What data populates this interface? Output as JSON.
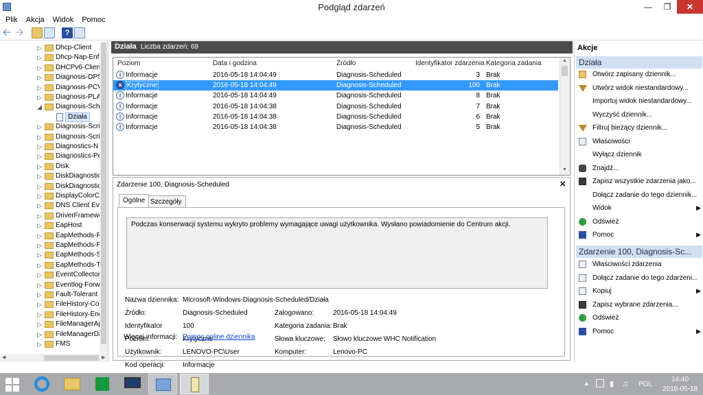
{
  "window": {
    "title": "Podgląd zdarzeń"
  },
  "menu": [
    "Plik",
    "Akcja",
    "Widok",
    "Pomoc"
  ],
  "tree": {
    "items": [
      {
        "label": "Dhcp-Client",
        "expander": "▷"
      },
      {
        "label": "Dhcp-Nap-Enf",
        "expander": "▷"
      },
      {
        "label": "DHCPv6-Clien",
        "expander": "▷"
      },
      {
        "label": "Diagnosis-DPS",
        "expander": "▷"
      },
      {
        "label": "Diagnosis-PCV",
        "expander": "▷"
      },
      {
        "label": "Diagnosis-PLA",
        "expander": "▷"
      },
      {
        "label": "Diagnosis-Sch",
        "expander": "◢"
      },
      {
        "label": "Działa",
        "expander": "",
        "child": true
      },
      {
        "label": "Diagnosis-Scri",
        "expander": "▷"
      },
      {
        "label": "Diagnosis-Scri",
        "expander": "▷"
      },
      {
        "label": "Diagnostics-N",
        "expander": "▷"
      },
      {
        "label": "Diagnostics-Pe",
        "expander": "▷"
      },
      {
        "label": "Disk",
        "expander": "▷"
      },
      {
        "label": "DiskDiagnostic",
        "expander": "▷"
      },
      {
        "label": "DiskDiagnostic",
        "expander": "▷"
      },
      {
        "label": "DisplayColorC",
        "expander": "▷"
      },
      {
        "label": "DNS Client Eve",
        "expander": "▷"
      },
      {
        "label": "DriverFramewo",
        "expander": "▷"
      },
      {
        "label": "EapHost",
        "expander": "▷"
      },
      {
        "label": "EapMethods-R",
        "expander": "▷"
      },
      {
        "label": "EapMethods-R",
        "expander": "▷"
      },
      {
        "label": "EapMethods-S",
        "expander": "▷"
      },
      {
        "label": "EapMethods-T",
        "expander": "▷"
      },
      {
        "label": "EventCollector",
        "expander": "▷"
      },
      {
        "label": "Eventlog-Forw",
        "expander": "▷"
      },
      {
        "label": "Fault-Tolerant",
        "expander": "▷"
      },
      {
        "label": "FileHistory-Co",
        "expander": "▷"
      },
      {
        "label": "FileHistory-Eng",
        "expander": "▷"
      },
      {
        "label": "FileManagerApp",
        "expander": "▷"
      },
      {
        "label": "FileManagerDa",
        "expander": "▷"
      },
      {
        "label": "FMS",
        "expander": "▷"
      }
    ]
  },
  "center": {
    "header_title": "Działa",
    "header_count": "Liczba zdarzeń: 69",
    "columns": [
      "Poziom",
      "Data i godzina",
      "Źródło",
      "Identyfikator zdarzenia",
      "Kategoria zadania"
    ],
    "rows": [
      {
        "level": "Informacje",
        "datetime": "2016-05-18 14:04:49",
        "source": "Diagnosis-Scheduled",
        "id": "3",
        "category": "Brak",
        "critical": false
      },
      {
        "level": "Krytyczne",
        "datetime": "2016-05-18 14:04:49",
        "source": "Diagnosis-Scheduled",
        "id": "100",
        "category": "Brak",
        "critical": true
      },
      {
        "level": "Informacje",
        "datetime": "2016-05-18 14:04:49",
        "source": "Diagnosis-Scheduled",
        "id": "8",
        "category": "Brak",
        "critical": false
      },
      {
        "level": "Informacje",
        "datetime": "2016-05-18 14:04:38",
        "source": "Diagnosis-Scheduled",
        "id": "7",
        "category": "Brak",
        "critical": false
      },
      {
        "level": "Informacje",
        "datetime": "2016-05-18 14:04:38",
        "source": "Diagnosis-Scheduled",
        "id": "6",
        "category": "Brak",
        "critical": false
      },
      {
        "level": "Informacje",
        "datetime": "2016-05-18 14:04:38",
        "source": "Diagnosis-Scheduled",
        "id": "5",
        "category": "Brak",
        "critical": false
      }
    ]
  },
  "detail": {
    "title": "Zdarzenie 100, Diagnosis-Scheduled",
    "tabs": [
      "Ogólne",
      "Szczegóły"
    ],
    "message": "Podczas konserwacji systemu wykryto problemy wymagające uwagi użytkownika. Wysłano powiadomienie do Centrum akcji.",
    "log_name_label": "Nazwa dziennika:",
    "log_name": "Microsoft-Windows-Diagnosis-Scheduled/Działa",
    "source_label": "Źródło:",
    "source": "Diagnosis-Scheduled",
    "logged_label": "Zalogowano:",
    "logged": "2016-05-18 14:04:49",
    "id_label": "Identyfikator",
    "id": "100",
    "category_label": "Kategoria zadania:",
    "category": "Brak",
    "level_label": "Poziom:",
    "level": "Krytyczne",
    "keywords_label": "Słowa kluczowe:",
    "keywords": "Słowo kluczowe WHC Notification",
    "user_label": "Użytkownik:",
    "user": "LENOVO-PC\\User",
    "computer_label": "Komputer:",
    "computer": "Lenovo-PC",
    "opcode_label": "Kod operacji:",
    "opcode": "Informacje",
    "more_label": "Więcej informacji:",
    "more_link": "Pomoc online dziennika"
  },
  "actions": {
    "header": "Akcje",
    "section1": "Działa",
    "items1": [
      {
        "label": "Otwórz zapisany dziennik...",
        "icon": "folder-icon",
        "arrow": ""
      },
      {
        "label": "Utwórz widok niestandardowy...",
        "icon": "filter-icon",
        "arrow": ""
      },
      {
        "label": "Importuj widok niestandardowy...",
        "icon": "",
        "arrow": ""
      },
      {
        "label": "Wyczyść dziennik...",
        "icon": "",
        "arrow": ""
      },
      {
        "label": "Filtruj bieżący dziennik...",
        "icon": "filter-icon",
        "arrow": ""
      },
      {
        "label": "Właściwości",
        "icon": "properties-icon",
        "arrow": ""
      },
      {
        "label": "Wyłącz dziennik",
        "icon": "",
        "arrow": ""
      },
      {
        "label": "Znajdź...",
        "icon": "binoculars-icon",
        "arrow": ""
      },
      {
        "label": "Zapisz wszystkie zdarzenia jako...",
        "icon": "save-icon",
        "arrow": ""
      },
      {
        "label": "Dołącz zadanie do tego dziennik...",
        "icon": "",
        "arrow": ""
      },
      {
        "label": "Widok",
        "icon": "",
        "arrow": "▶"
      },
      {
        "label": "Odśwież",
        "icon": "refresh-icon",
        "arrow": ""
      },
      {
        "label": "Pomoc",
        "icon": "help-icon",
        "arrow": "▶"
      }
    ],
    "section2": "Zdarzenie 100, Diagnosis-Sc...",
    "items2": [
      {
        "label": "Właściwości zdarzenia",
        "icon": "properties-icon",
        "arrow": ""
      },
      {
        "label": "Dołącz zadanie do tego zdarzeni...",
        "icon": "task-icon",
        "arrow": ""
      },
      {
        "label": "Kopiuj",
        "icon": "copy-icon",
        "arrow": "▶"
      },
      {
        "label": "Zapisz wybrane zdarzenia...",
        "icon": "save-icon",
        "arrow": ""
      },
      {
        "label": "Odśwież",
        "icon": "refresh-icon",
        "arrow": ""
      },
      {
        "label": "Pomoc",
        "icon": "help-icon",
        "arrow": "▶"
      }
    ]
  },
  "taskbar": {
    "lang": "POL",
    "time": "14:40",
    "date": "2016-05-18"
  },
  "colors": {
    "selection": "#3399ff",
    "section": "#cfe0f3",
    "header": "#4a4a4a",
    "taskbar": "#a9aaad"
  }
}
